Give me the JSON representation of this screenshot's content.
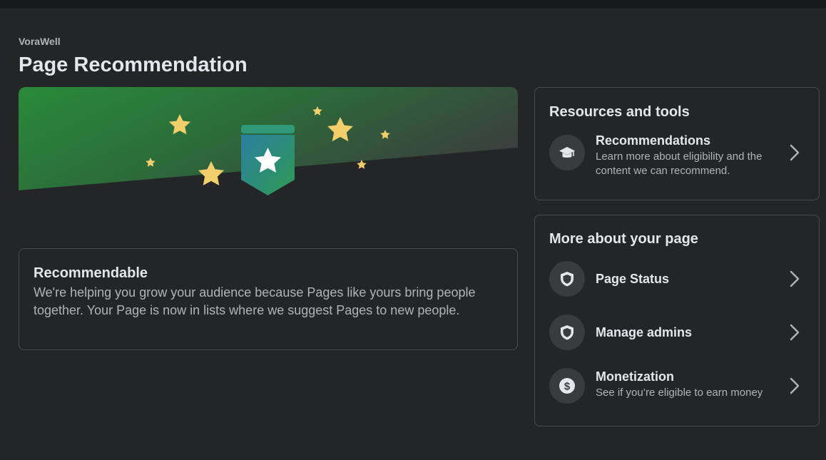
{
  "header": {
    "page_name": "VoraWell",
    "title": "Page Recommendation"
  },
  "status": {
    "title": "Recommendable",
    "description": "We're helping you grow your audience because Pages like yours bring people together. Your Page is now in lists where we suggest Pages to new people."
  },
  "resources": {
    "title": "Resources and tools",
    "items": [
      {
        "label": "Recommendations",
        "subtitle": "Learn more about eligibility and the content we can recommend.",
        "icon": "graduation-cap-icon"
      }
    ]
  },
  "more": {
    "title": "More about your page",
    "items": [
      {
        "label": "Page Status",
        "icon": "shield-icon"
      },
      {
        "label": "Manage admins",
        "icon": "shield-icon"
      },
      {
        "label": "Monetization",
        "subtitle": "See if you’re eligible to earn money",
        "icon": "dollar-coin-icon"
      }
    ]
  },
  "colors": {
    "background": "#242526",
    "banner_green": "#2e8b3e",
    "badge_teal": "#2a8f8f",
    "star_yellow": "#f2cf6a"
  }
}
